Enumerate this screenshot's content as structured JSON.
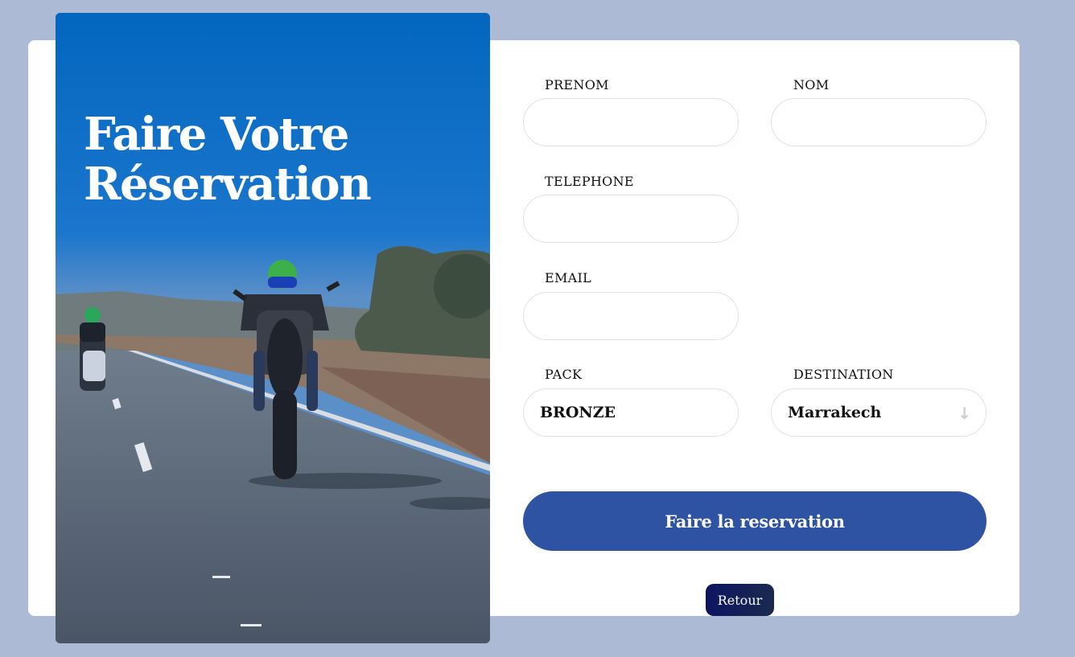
{
  "hero": {
    "title_line1": "Faire Votre",
    "title_line2": "Réservation"
  },
  "form": {
    "prenom": {
      "label": "PRENOM",
      "value": ""
    },
    "nom": {
      "label": "NOM",
      "value": ""
    },
    "telephone": {
      "label": "TELEPHONE",
      "value": ""
    },
    "email": {
      "label": "EMAIL",
      "value": ""
    },
    "pack": {
      "label": "PACK",
      "value": "BRONZE"
    },
    "destination": {
      "label": "DESTINATION",
      "value": "Marrakech",
      "icon": "arrow-down-icon"
    },
    "submit_label": "Faire la reservation",
    "back_label": "Retour"
  },
  "colors": {
    "background": "#adbad6",
    "submit": "#2e53a3",
    "back": "#0e1461"
  }
}
